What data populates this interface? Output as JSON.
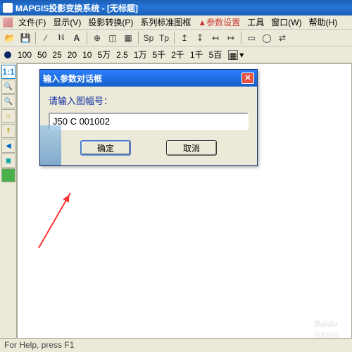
{
  "window": {
    "title": "MAPGIS投影变换系统 - [无标题]"
  },
  "menu": {
    "file": "文件(F)",
    "display": "显示(V)",
    "proj": "投影转换(P)",
    "series": "系列标准图框",
    "params": "▲参数设置",
    "tools": "工具",
    "window": "窗口(W)",
    "help": "帮助(H)"
  },
  "toolbar1": {
    "sp": "Sp",
    "tp": "Tp"
  },
  "toolbar2": {
    "s1": "100",
    "s2": "50",
    "s3": "25",
    "s4": "20",
    "s5": "10",
    "s6": "5万",
    "s7": "2.5",
    "s8": "1万",
    "s9": "5千",
    "s10": "2千",
    "s11": "1千",
    "s12": "5百"
  },
  "vtb": {
    "b1": "1:1"
  },
  "dialog": {
    "title": "输入参数对话框",
    "prompt": "请输入图幅号：",
    "value": "J50 C 001002",
    "ok": "确定",
    "cancel": "取消"
  },
  "status": {
    "text": "For Help, press F1"
  },
  "watermark": {
    "brand": "Baidu",
    "sub": "百度经验"
  }
}
